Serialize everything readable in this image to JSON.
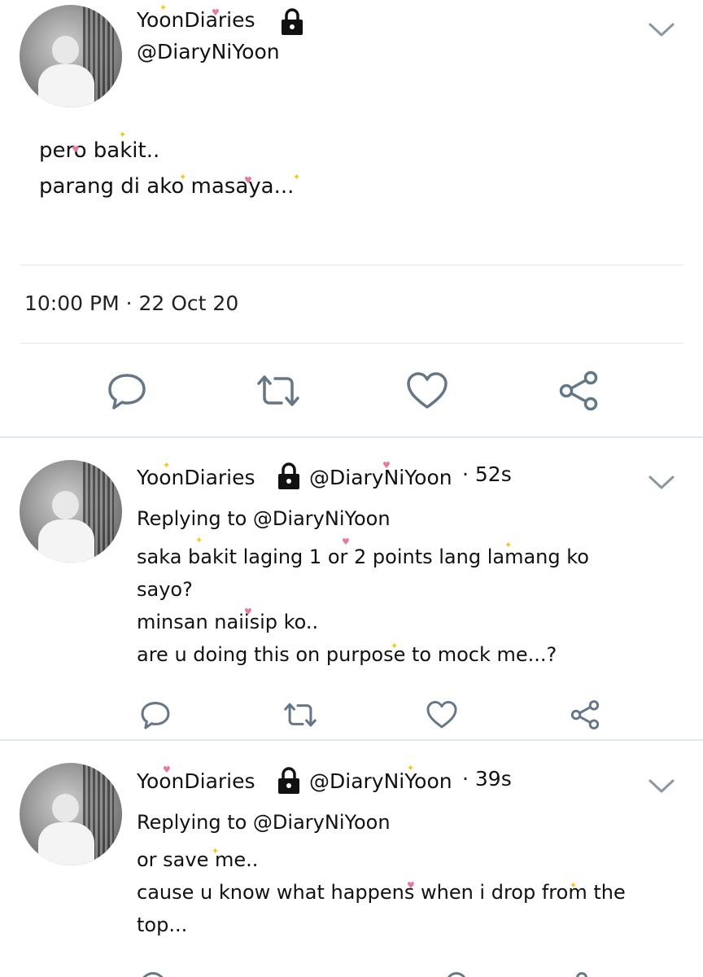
{
  "colors": {
    "icon_stroke": "#657786",
    "chevron": "#8899a6",
    "text": "#111111",
    "sparkle_yellow": "#f5c518",
    "sparkle_pink": "#e8799a"
  },
  "main_tweet": {
    "display_name": "YoonDiaries",
    "handle": "@DiaryNiYoon",
    "text": "pero bakit..\nparang di ako masaya...",
    "timestamp": "10:00 PM · 22 Oct 20",
    "actions": [
      "reply-icon",
      "retweet-icon",
      "like-icon",
      "share-icon"
    ]
  },
  "replies": [
    {
      "display_name": "YoonDiaries",
      "handle": "@DiaryNiYoon",
      "time": "· 52s",
      "replying_to": "Replying to @DiaryNiYoon",
      "text": "saka bakit laging 1 or 2 points lang lamang ko\nsayo?\nminsan naiisip ko..\nare u doing this on purpose to mock me...?"
    },
    {
      "display_name": "YoonDiaries",
      "handle": "@DiaryNiYoon",
      "time": "· 39s",
      "replying_to": "Replying to @DiaryNiYoon",
      "text": "or save me..\ncause u know what happens when i drop from the\ntop..."
    }
  ]
}
